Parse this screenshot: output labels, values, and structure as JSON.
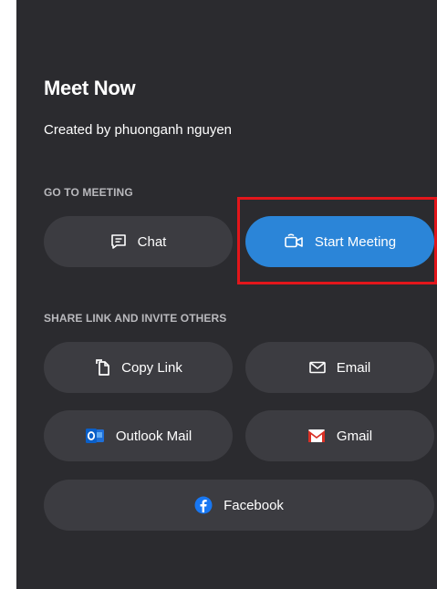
{
  "header": {
    "title": "Meet Now",
    "subtitle": "Created by phuonganh nguyen"
  },
  "sections": {
    "go_to_meeting": "GO TO MEETING",
    "share_link": "SHARE LINK AND INVITE OTHERS"
  },
  "buttons": {
    "chat": "Chat",
    "start_meeting": "Start Meeting",
    "copy_link": "Copy Link",
    "email": "Email",
    "outlook_mail": "Outlook Mail",
    "gmail": "Gmail",
    "facebook": "Facebook"
  },
  "icons": {
    "chat": "chat-icon",
    "start_meeting": "video-camera-icon",
    "copy_link": "copy-icon",
    "email": "envelope-icon",
    "outlook_mail": "outlook-icon",
    "gmail": "gmail-icon",
    "facebook": "facebook-icon"
  },
  "colors": {
    "panel_bg": "#2b2b2f",
    "button_bg": "#3c3c41",
    "primary": "#2b85d8",
    "highlight": "#e3161b"
  }
}
